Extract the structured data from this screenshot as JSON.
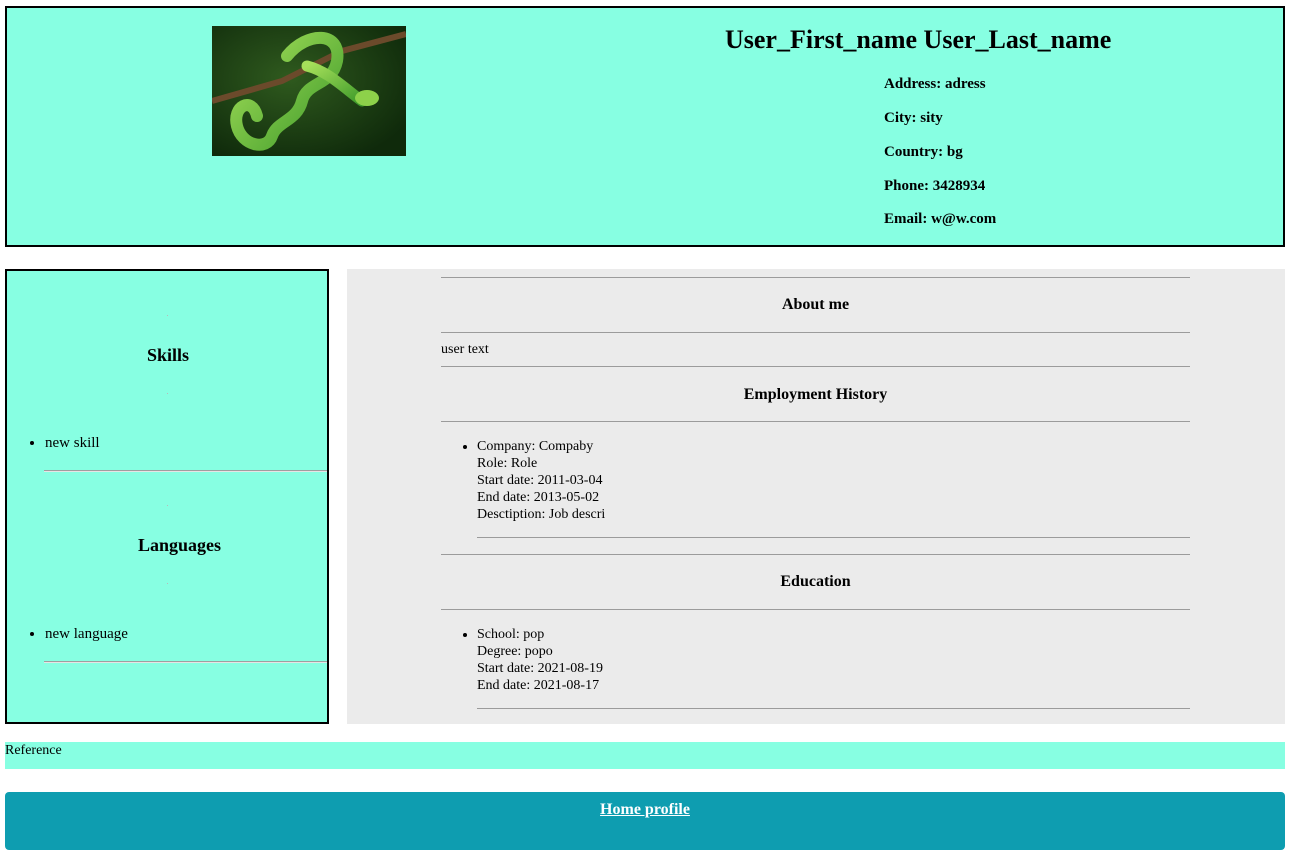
{
  "header": {
    "name": "User_First_name User_Last_name",
    "info": [
      "Address: adress",
      "City: sity",
      "Country: bg",
      "Phone: 3428934",
      "Email: w@w.com"
    ]
  },
  "sidebar": {
    "skills_title": "Skills",
    "skills": [
      "new skill"
    ],
    "languages_title": "Languages",
    "languages": [
      "new language"
    ]
  },
  "main": {
    "about_title": "About me",
    "about_text": "user text",
    "employment_title": "Employment History",
    "employment": [
      {
        "company": "Company: Compaby",
        "role": "Role: Role",
        "start": "Start date: 2011-03-04",
        "end": "End date: 2013-05-02",
        "description": "Desctiption: Job descri"
      }
    ],
    "education_title": "Education",
    "education": [
      {
        "school": "School: pop",
        "degree": "Degree: popo",
        "start": "Start date: 2021-08-19",
        "end": "End date: 2021-08-17"
      }
    ]
  },
  "footer": {
    "reference_label": "Reference",
    "home_link": "Home profile"
  },
  "colors": {
    "panel": "#87ffe2",
    "main_bg": "#ebebeb",
    "home_bar": "#0e9db0"
  }
}
